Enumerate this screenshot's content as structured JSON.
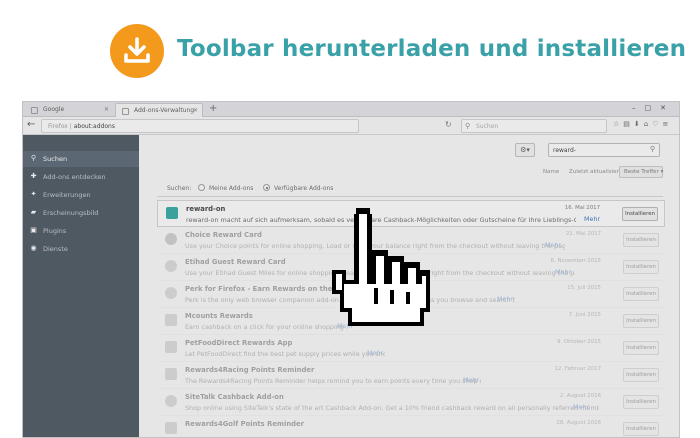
{
  "hero": {
    "title": "Toolbar herunterladen und installieren",
    "accent_color": "#f39a1d",
    "title_color": "#3aa1a8",
    "icon": "download-icon"
  },
  "browser": {
    "tabs": [
      {
        "label": "Google"
      },
      {
        "label": "Add-ons-Verwaltung"
      }
    ],
    "url_prefix": "Firefox",
    "url": "about:addons",
    "search_placeholder": "Suchen"
  },
  "sidebar": {
    "items": [
      {
        "label": "Suchen",
        "icon": "search-icon",
        "active": true
      },
      {
        "label": "Add-ons entdecken",
        "icon": "puzzle-icon",
        "active": false
      },
      {
        "label": "Erweiterungen",
        "icon": "extension-icon",
        "active": false
      },
      {
        "label": "Erscheinungsbild",
        "icon": "brush-icon",
        "active": false
      },
      {
        "label": "Plugins",
        "icon": "plugin-icon",
        "active": false
      },
      {
        "label": "Dienste",
        "icon": "services-icon",
        "active": false
      }
    ]
  },
  "content": {
    "search_value": "reward-",
    "sort": {
      "name": "Name",
      "last_updated": "Zuletzt aktualisiert",
      "best_match": "Beste Treffer"
    },
    "filter": {
      "label": "Suchen:",
      "option1": "Meine Add-ons",
      "option2": "Verfügbare Add-ons"
    },
    "results": [
      {
        "name": "reward-on",
        "desc": "reward-on macht auf sich aufmerksam, sobald es verfügbare Cashback-Möglichkeiten oder Gutscheine für Ihre Lieblings-Onlineshops gibt.",
        "more": "Mehr",
        "date": "16. Mai 2017",
        "button": "Installieren"
      },
      {
        "name": "Choice Reward Card",
        "desc": "Use your Choice points for online shopping. Load or view your balance right from the checkout without leaving the page!",
        "more": "Mehr",
        "date": "22. Mai 2017",
        "button": "Installieren"
      },
      {
        "name": "Etihad Guest Reward Card",
        "desc": "Use your Etihad Guest Miles for online shopping. Load or view your balance right from the checkout without leaving the page!",
        "more": "Mehr",
        "date": "6. November 2015",
        "button": "Installieren"
      },
      {
        "name": "Perk for Firefox - Earn Rewards on the Web!",
        "desc": "Perk is the only web browser companion add-on that lets you earn rewards as you browse and search the web.",
        "more": "Mehr",
        "date": "15. Juli 2015",
        "button": "Installieren"
      },
      {
        "name": "Mcounts Rewards",
        "desc": "Earn cashback on a click for your online shopping .",
        "more": "Mehr",
        "date": "7. Juni 2015",
        "button": "Installieren"
      },
      {
        "name": "PetFoodDirect Rewards App",
        "desc": "Let PetFoodDirect find the best pet supply prices while you shop.",
        "more": "Mehr",
        "date": "9. Oktober 2015",
        "button": "Installieren"
      },
      {
        "name": "Rewards4Racing Points Reminder",
        "desc": "The Rewards4Racing Points Reminder helps remind you to earn points every time you shop online.",
        "more": "Mehr",
        "date": "12. Februar 2017",
        "button": "Installieren"
      },
      {
        "name": "SiteTalk Cashback Add-on",
        "desc": "Shop online using SiteTalk's state of the art Cashback Add-on. Get a 10% friend cashback reward on all personally referred members.",
        "more": "Mehr",
        "date": "2. August 2016",
        "button": "Installieren"
      },
      {
        "name": "Rewards4Golf Points Reminder",
        "desc": "",
        "more": "",
        "date": "28. August 2016",
        "button": "Installieren"
      }
    ]
  }
}
